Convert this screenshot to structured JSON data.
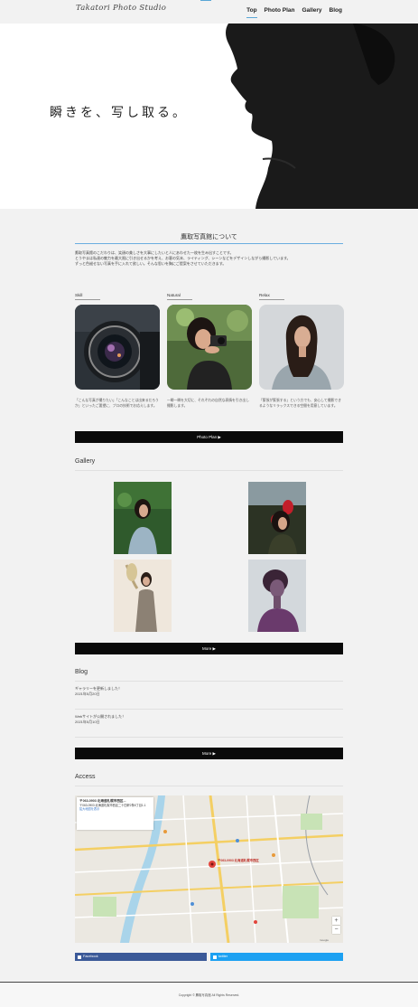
{
  "header": {
    "logo": "Takatori Photo Studio",
    "nav": [
      "Top",
      "Photo Plan",
      "Gallery",
      "Blog"
    ],
    "active_index": 0
  },
  "hero": {
    "tagline": "瞬きを、写し取る。"
  },
  "about": {
    "title": "鷹取写真館について",
    "lines": [
      "鷹取写真館のこだわりは、笑顔の美しさを大事にしたいと人にあわせた一枚を生み出すことです。",
      "とうやまは私達の魅力を最大限に引き出せるかを考え、お客の気末、ライティング、シーンなどをデザインしながら撮影しています。",
      "ずっと色褪せない写真を手に入れて欲しい。そんな思いを胸にご提案をさせていただきます。"
    ],
    "features": [
      {
        "label": "Skill",
        "text": "「こんな写真が撮りたい」「こんなことは出来るだろうか」といったご要望に、プロの技術でお応えします。"
      },
      {
        "label": "Natural",
        "text": "一瞬一瞬を大切に、それぞれの自然な表情を引き出し撮影します。"
      },
      {
        "label": "Relax",
        "text": "「緊張が緊張する」という方でも、安心して撮影できるようなリラックスできる空間を用意しています。"
      }
    ],
    "button": "Photo Plan ▶"
  },
  "gallery": {
    "title": "Gallery",
    "button": "More ▶"
  },
  "blog": {
    "title": "Blog",
    "posts": [
      {
        "title": "ギャラリーを更新しました！",
        "date": "2021年5月20日"
      },
      {
        "title": "Webサイトが公開されました！",
        "date": "2021年5月10日"
      }
    ],
    "button": "More ▶"
  },
  "access": {
    "title": "Access",
    "map_card": {
      "title": "〒063-0903 北海道札幌市西区...",
      "address": "〒063-0903 北海道札幌市西区二十四軒2条6丁目1-1",
      "link": "拡大地図を表示"
    },
    "marker_label": "〒063-0903 北海道札幌市西区",
    "zoom_in": "+",
    "zoom_out": "−",
    "map_footer": "Google"
  },
  "social": {
    "facebook": "Facebook",
    "twitter": "twitter",
    "facebook_color": "#3b5998",
    "twitter_color": "#1da1f2"
  },
  "footer": {
    "copyright": "Copyright © 鷹取写真館 All Rights Reserved."
  }
}
